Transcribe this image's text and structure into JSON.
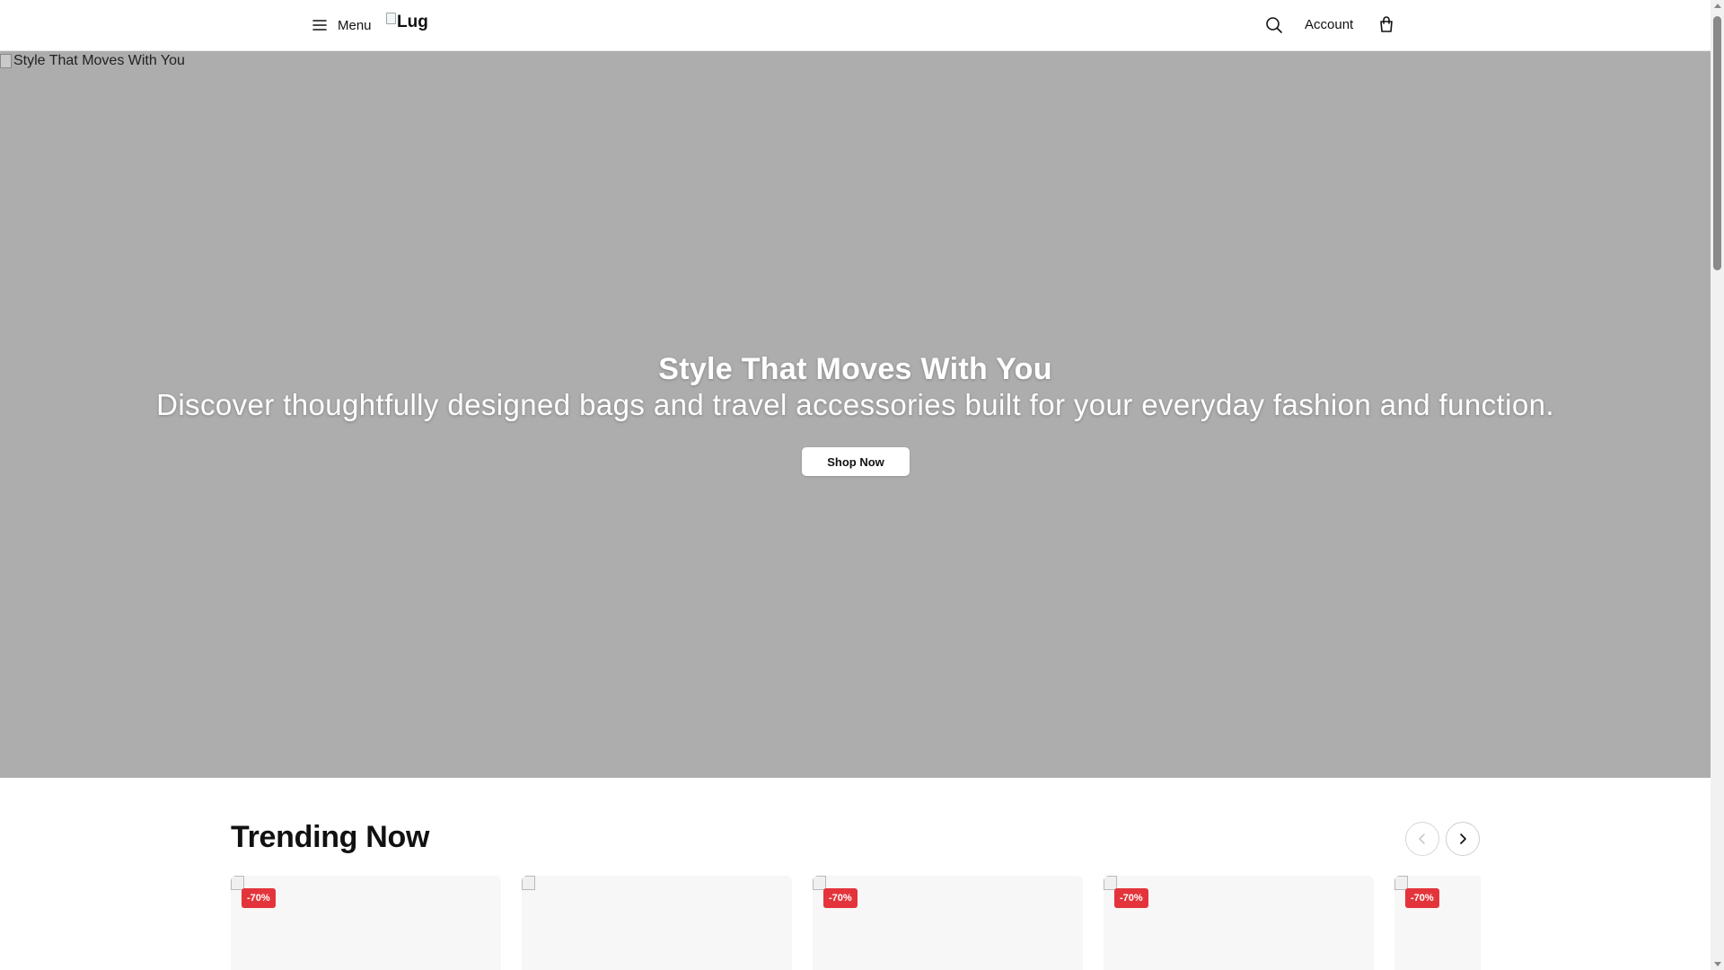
{
  "header": {
    "menu_label": "Menu",
    "logo_text": "Lug",
    "account_label": "Account",
    "icons": {
      "menu": "hamburger-icon",
      "search": "search-icon",
      "cart": "shopping-bag-icon"
    }
  },
  "hero": {
    "image_alt": "Style That Moves With You",
    "title": "Style That Moves With You",
    "subtitle": "Discover thoughtfully designed bags and travel accessories built for your everyday fashion and function.",
    "cta_label": "Shop Now",
    "background_color": "#adadad"
  },
  "trending": {
    "title": "Trending Now",
    "products": [
      {
        "badge": "-70%"
      },
      {
        "badge": ""
      },
      {
        "badge": "-70%"
      },
      {
        "badge": "-70%"
      },
      {
        "badge": "-70%"
      }
    ]
  },
  "colors": {
    "badge": "#e4343b",
    "card_bg": "#f7f7f7"
  }
}
